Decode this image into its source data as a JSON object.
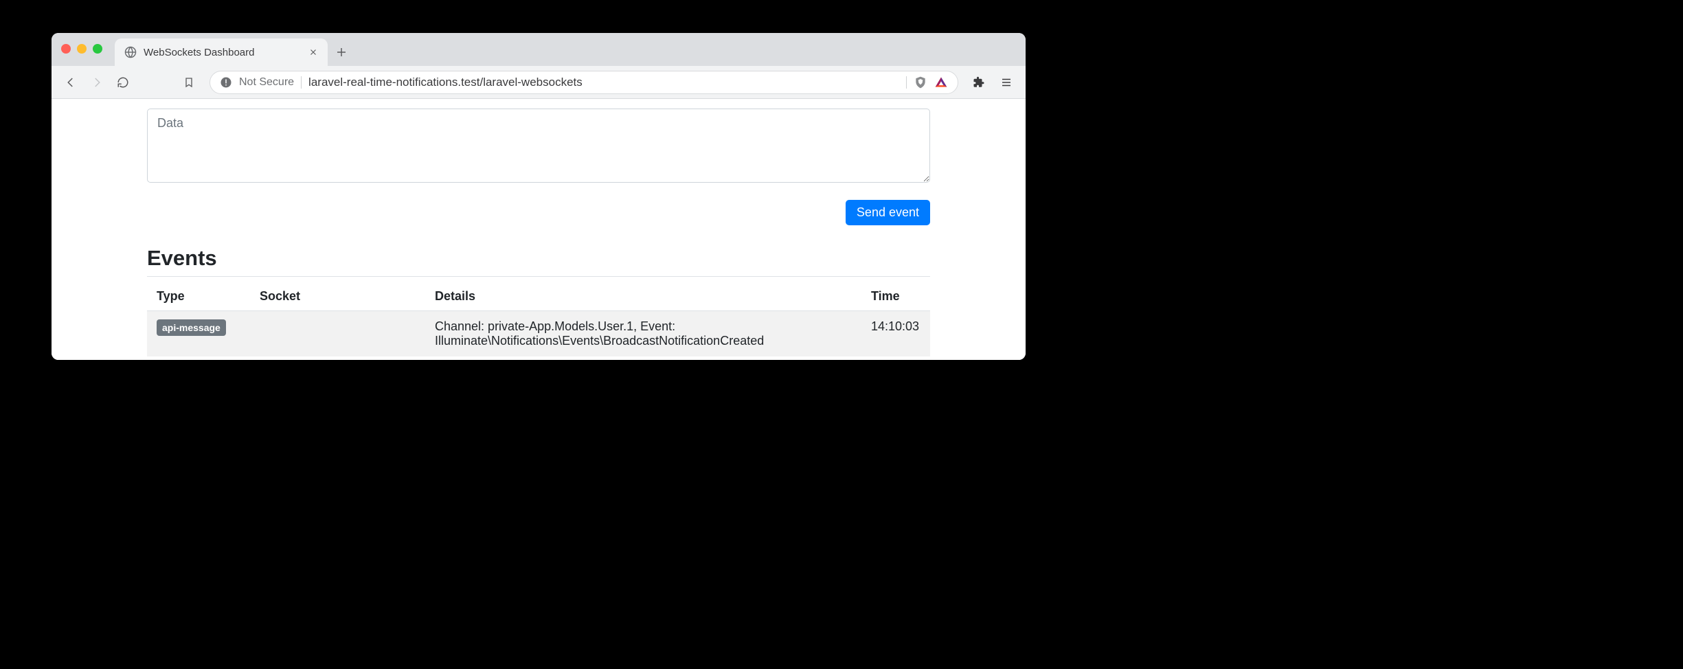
{
  "browser": {
    "tab_title": "WebSockets Dashboard",
    "not_secure_label": "Not Secure",
    "url": "laravel-real-time-notifications.test/laravel-websockets"
  },
  "form": {
    "data_placeholder": "Data",
    "data_value": "",
    "send_button_label": "Send event"
  },
  "events_section": {
    "heading": "Events",
    "columns": {
      "type": "Type",
      "socket": "Socket",
      "details": "Details",
      "time": "Time"
    },
    "rows": [
      {
        "type_badge": "api-message",
        "socket": "",
        "details": "Channel: private-App.Models.User.1, Event: Illuminate\\Notifications\\Events\\BroadcastNotificationCreated",
        "time": "14:10:03"
      }
    ]
  }
}
